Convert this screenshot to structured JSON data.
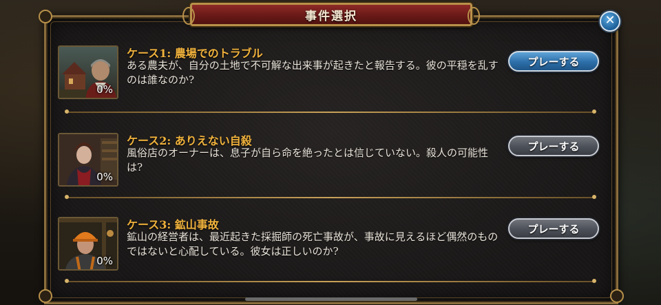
{
  "header": {
    "title": "事件選択",
    "close_icon": "close-icon"
  },
  "cases": [
    {
      "title": "ケース1: 農場でのトラブル",
      "description": "ある農夫が、自分の土地で不可解な出来事が起きたと報告する。彼の平穏を乱すのは誰なのか?",
      "progress": "0%",
      "button": "プレーする",
      "button_style": "primary"
    },
    {
      "title": "ケース2:  ありえない自殺",
      "description": "風俗店のオーナーは、息子が自ら命を絶ったとは信じていない。殺人の可能性は?",
      "progress": "0%",
      "button": "プレーする",
      "button_style": "secondary"
    },
    {
      "title": "ケース3:  鉱山事故",
      "description": "鉱山の経営者は、最近起きた採掘師の死亡事故が、事故に見えるほど偶然のものではないと心配している。彼女は正しいのか?",
      "progress": "0%",
      "button": "プレーする",
      "button_style": "secondary"
    }
  ],
  "colors": {
    "title_gold": "#f0b23c",
    "banner_red": "#6a1a18",
    "primary_button": "#2c6ea8",
    "secondary_button": "#4c5058"
  }
}
